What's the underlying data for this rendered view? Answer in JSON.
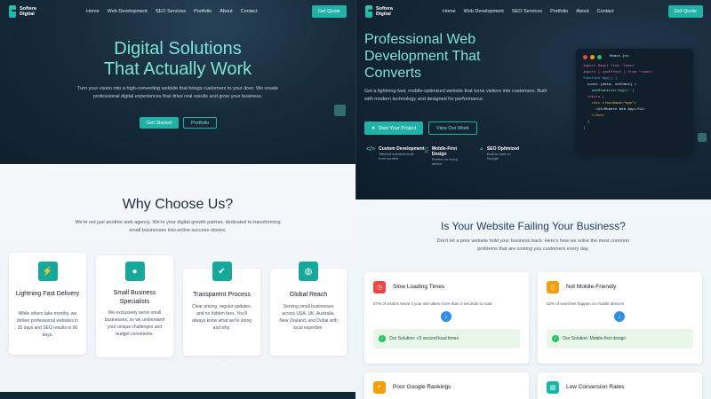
{
  "brand": {
    "line1": "Softera",
    "line2": "Digital"
  },
  "nav": [
    "Home",
    "Web Development",
    "SEO Services",
    "Portfolio",
    "About",
    "Contact"
  ],
  "get_quote": "Get Quote",
  "left": {
    "hero": {
      "title_line1": "Digital Solutions",
      "title_line2": "That Actually Work",
      "subtitle": "Turn your vision into a high-converting website that brings customers to your door. We create professional digital experiences that drive real results and grow your business.",
      "btn_primary": "Get Started",
      "btn_secondary": "Portfolio"
    },
    "why": {
      "title": "Why Choose Us?",
      "subtitle": "We're not just another web agency. We're your digital growth partner, dedicated to transforming small businesses into online success stories.",
      "cards": [
        {
          "icon": "lightning-icon",
          "glyph": "⚡",
          "title": "Lightning Fast Delivery",
          "text": "While others take months, we deliver professional websites in 30 days and SEO results in 90 days."
        },
        {
          "icon": "location-pin-icon",
          "glyph": "●",
          "title": "Small Business Specialists",
          "text": "We exclusively serve small businesses, so we understand your unique challenges and budget constraints."
        },
        {
          "icon": "checkmark-icon",
          "glyph": "✔",
          "title": "Transparent Process",
          "text": "Clear pricing, regular updates, and no hidden fees. You'll always know what we're doing and why."
        },
        {
          "icon": "globe-icon",
          "glyph": "◍",
          "title": "Global Reach",
          "text": "Serving small businesses across USA, UK, Australia, New Zealand, and Dubai with local expertise."
        }
      ]
    }
  },
  "right": {
    "hero": {
      "title_line1": "Professional Web",
      "title_line2": "Development That",
      "title_line3": "Converts",
      "subtitle": "Get a lightning-fast, mobile-optimized website that turns visitors into customers. Built with modern technology and designed for performance.",
      "btn_primary": "Start Your Project",
      "btn_secondary": "View Our Work"
    },
    "code": {
      "filename": "React.jsx",
      "lines": [
        {
          "t": "import React from 'react'",
          "c": "#f472b6"
        },
        {
          "t": "import { useEffect } from 'react'",
          "c": "#f472b6"
        },
        {
          "t": "function App() {",
          "c": "#60a5fa"
        },
        {
          "t": "  const [data, setData] =",
          "c": "#e5e7eb"
        },
        {
          "t": "    useState<string>('')",
          "c": "#86efac"
        },
        {
          "t": "  return (",
          "c": "#f472b6"
        },
        {
          "t": "    <div className=\"app\">",
          "c": "#fbbf24"
        },
        {
          "t": "      <h1>Modern Web App</h1>",
          "c": "#e5e7eb"
        },
        {
          "t": "    </div>",
          "c": "#fbbf24"
        },
        {
          "t": "  )",
          "c": "#e5e7eb"
        },
        {
          "t": "}",
          "c": "#60a5fa"
        }
      ]
    },
    "features": [
      {
        "icon": "code-icon",
        "glyph": "</>",
        "title": "Custom Development",
        "sub": "Tailored solutions built from scratch"
      },
      {
        "icon": "mobile-icon",
        "glyph": "▯",
        "title": "Mobile-First Design",
        "sub": "Perfect on every device"
      },
      {
        "icon": "search-icon",
        "glyph": "⌕",
        "title": "SEO Optimized",
        "sub": "Built to rank on Google"
      }
    ],
    "failing": {
      "title": "Is Your Website Failing Your Business?",
      "subtitle": "Don't let a poor website hold your business back. Here's how we solve the most common problems that are costing you customers every day.",
      "cards": [
        {
          "icon": "clock-icon",
          "glyph": "◷",
          "color": "#ef4444",
          "title": "Slow Loading Times",
          "text": "57% of visitors leave if your site takes more than 3 seconds to load",
          "solution": "Our Solution: <3 second load times"
        },
        {
          "icon": "mobile-icon",
          "glyph": "▯",
          "color": "#f59e0b",
          "title": "Not Mobile-Friendly",
          "text": "63% of searches happen on mobile devices",
          "solution": "Our Solution: Mobile-first design"
        },
        {
          "icon": "search-icon",
          "glyph": "⌕",
          "color": "#f59e0b",
          "title": "Poor Google Rankings",
          "text": "",
          "solution": ""
        },
        {
          "icon": "chart-icon",
          "glyph": "▥",
          "color": "#14b8a6",
          "title": "Low Conversion Rates",
          "text": "",
          "solution": ""
        }
      ]
    }
  }
}
